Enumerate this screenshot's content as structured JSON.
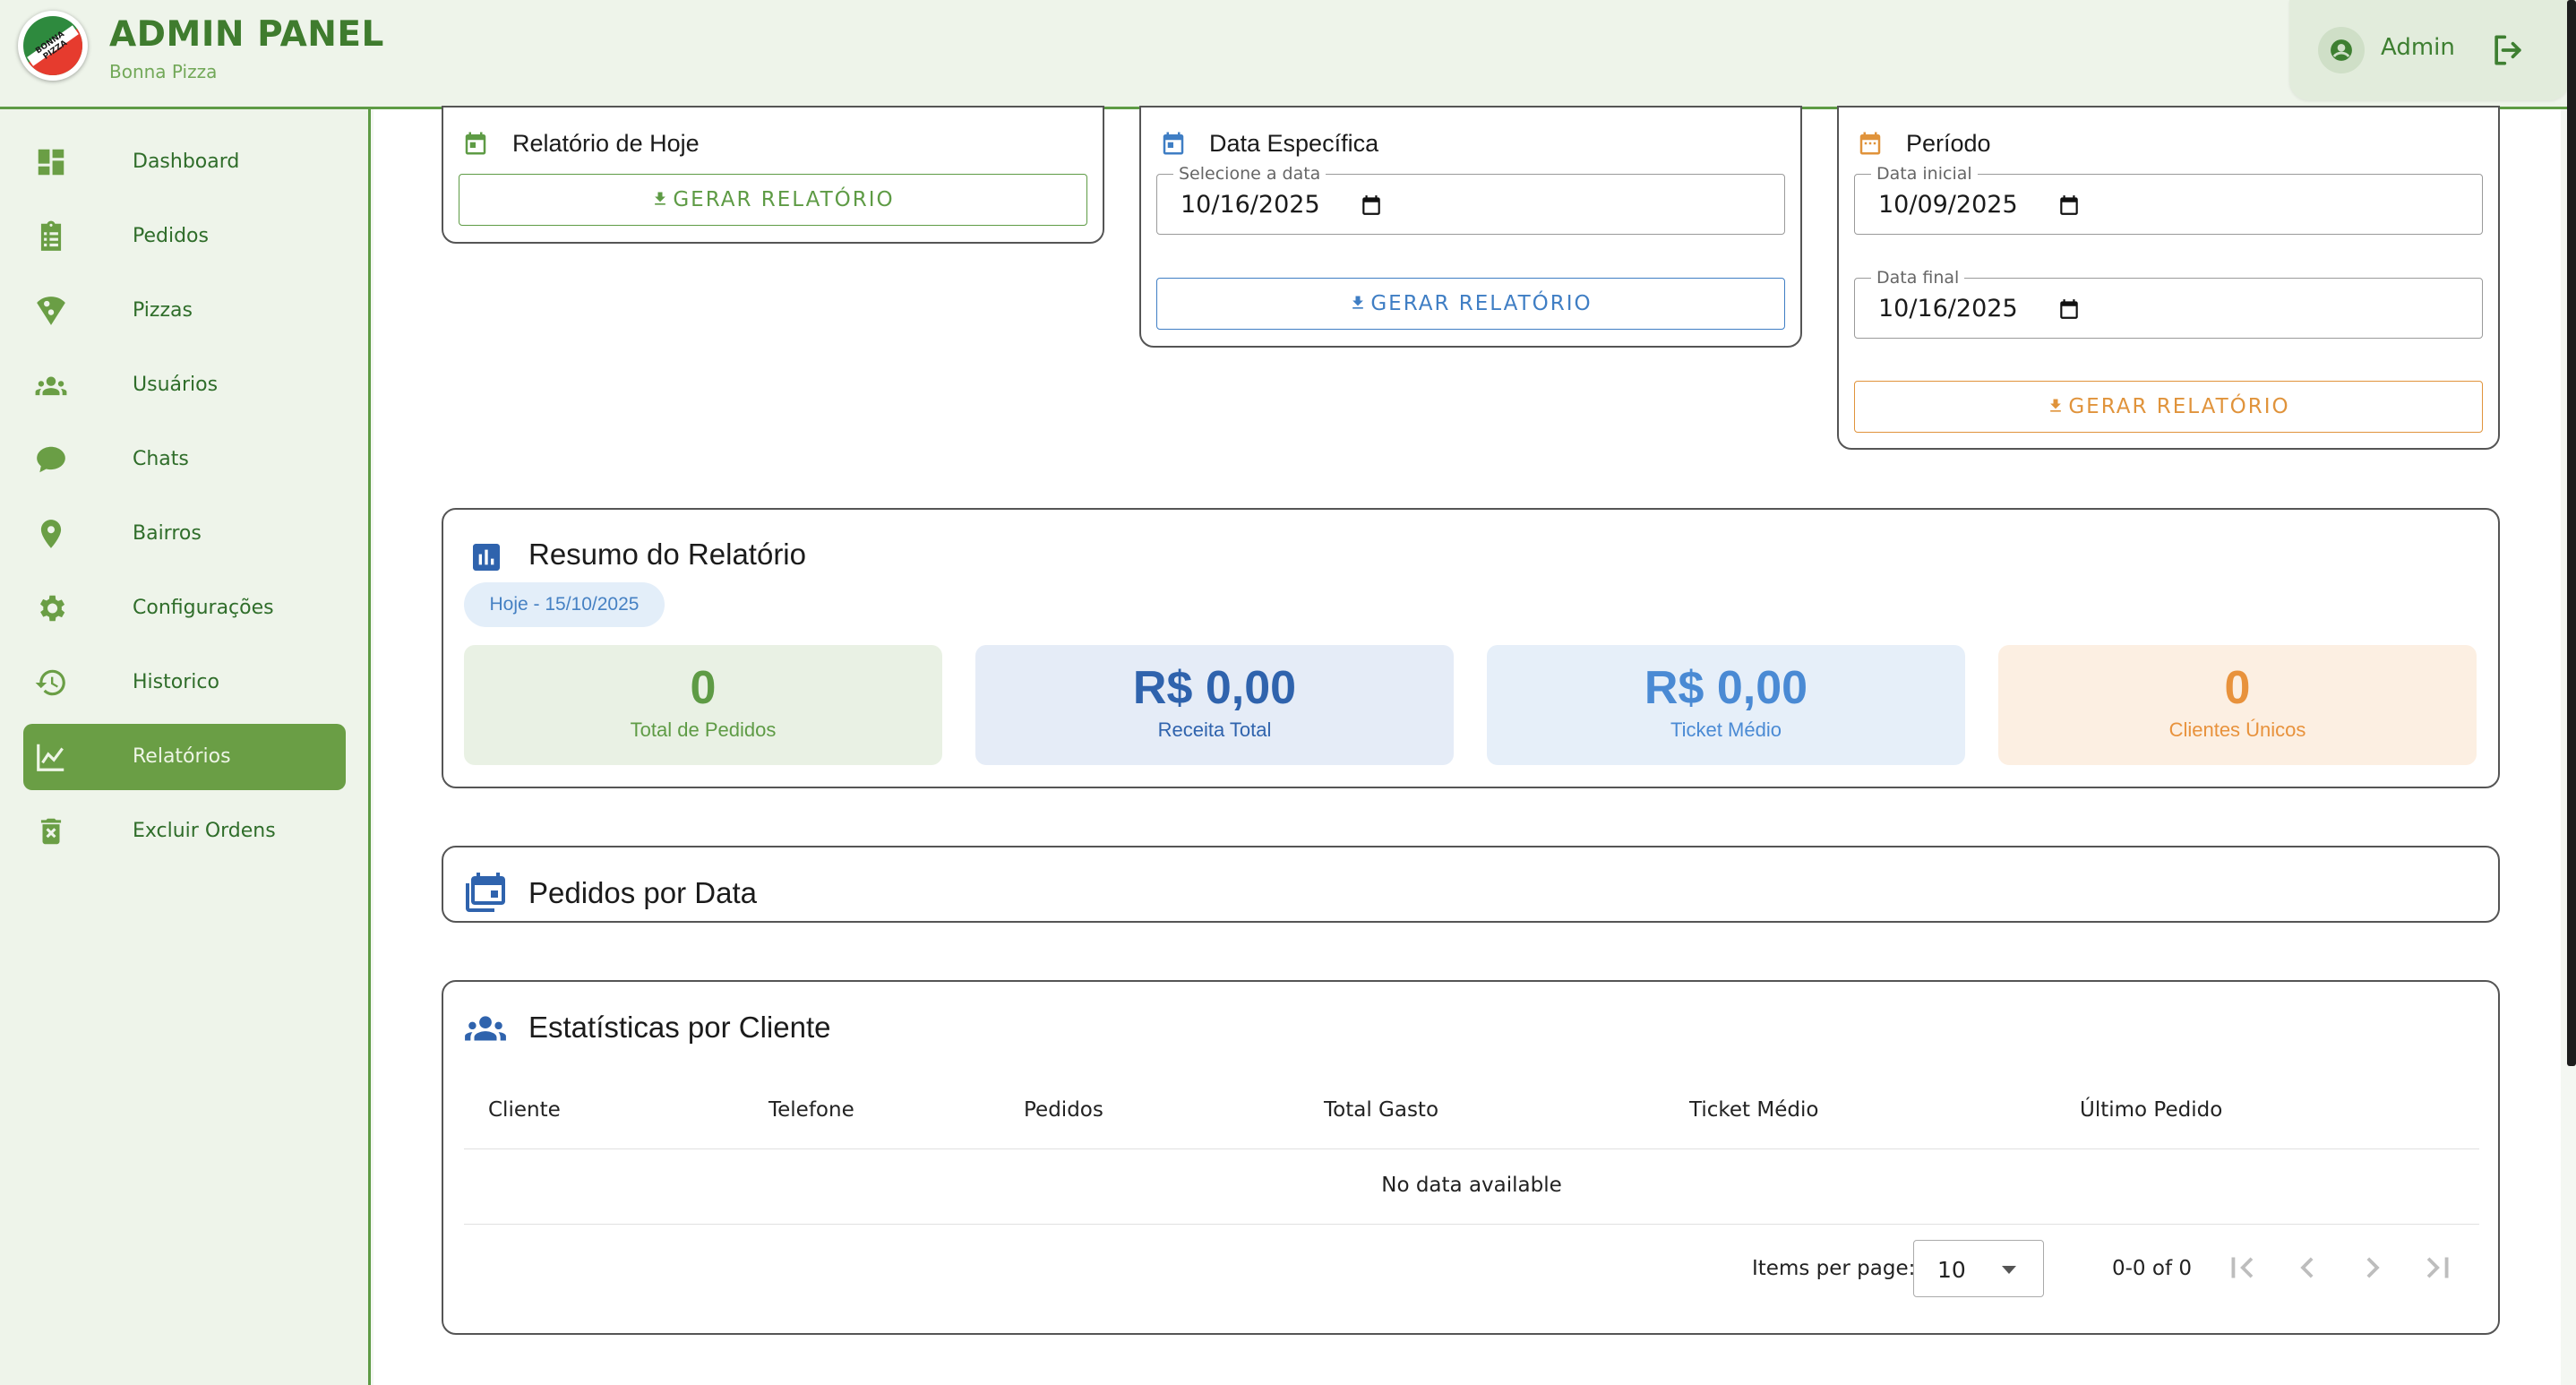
{
  "header": {
    "title": "ADMIN PANEL",
    "subtitle": "Bonna Pizza",
    "logo_text": "BONNA PIZZA",
    "user": "Admin"
  },
  "sidebar": {
    "items": [
      {
        "label": "Dashboard",
        "icon": "dashboard-icon"
      },
      {
        "label": "Pedidos",
        "icon": "clipboard-icon"
      },
      {
        "label": "Pizzas",
        "icon": "pizza-icon"
      },
      {
        "label": "Usuários",
        "icon": "people-icon"
      },
      {
        "label": "Chats",
        "icon": "chat-icon"
      },
      {
        "label": "Bairros",
        "icon": "location-pin-icon"
      },
      {
        "label": "Configurações",
        "icon": "gear-icon"
      },
      {
        "label": "Historico",
        "icon": "history-icon"
      },
      {
        "label": "Relatórios",
        "icon": "chart-line-icon",
        "active": true
      },
      {
        "label": "Excluir Ordens",
        "icon": "trash-icon"
      }
    ]
  },
  "report_today": {
    "title": "Relatório de Hoje",
    "button": "GERAR RELATÓRIO",
    "color": "#5e9b45"
  },
  "report_specific": {
    "title": "Data Específica",
    "date_label": "Selecione a data",
    "date_value": "10/16/2025",
    "button": "GERAR RELATÓRIO",
    "color": "#3f7ec4"
  },
  "report_period": {
    "title": "Período",
    "start_label": "Data inicial",
    "start_value": "10/09/2025",
    "end_label": "Data final",
    "end_value": "10/16/2025",
    "button": "GERAR RELATÓRIO",
    "color": "#e0933b"
  },
  "summary": {
    "title": "Resumo do Relatório",
    "chip": "Hoje - 15/10/2025",
    "stats": [
      {
        "value": "0",
        "label": "Total de Pedidos",
        "color": "#5e9b45",
        "bg": "#e9f1e4"
      },
      {
        "value": "R$ 0,00",
        "label": "Receita Total",
        "color": "#2f63ad",
        "bg": "#e5ecf7"
      },
      {
        "value": "R$ 0,00",
        "label": "Ticket Médio",
        "color": "#4a8ad4",
        "bg": "#e6eff9"
      },
      {
        "value": "0",
        "label": "Clientes Únicos",
        "color": "#e8923c",
        "bg": "#fcefe2"
      }
    ]
  },
  "orders_by_date": {
    "title": "Pedidos por Data"
  },
  "client_stats": {
    "title": "Estatísticas por Cliente",
    "columns": [
      "Cliente",
      "Telefone",
      "Pedidos",
      "Total Gasto",
      "Ticket Médio",
      "Último Pedido"
    ],
    "empty": "No data available",
    "items_per_page_label": "Items per page:",
    "items_per_page": "10",
    "range": "0-0 of 0"
  }
}
